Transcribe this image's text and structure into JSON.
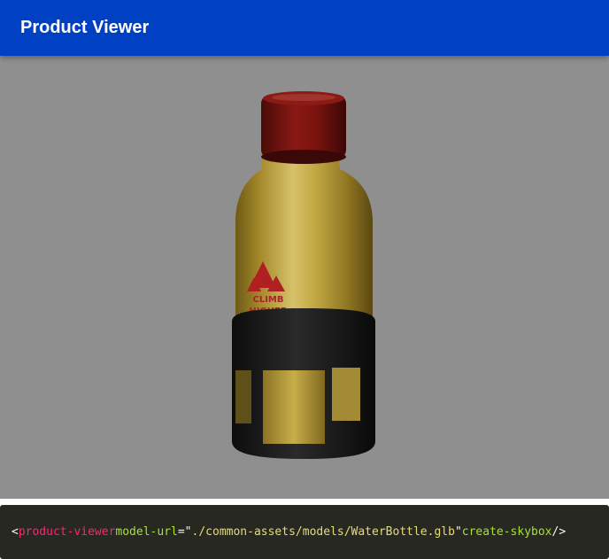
{
  "header": {
    "title": "Product Viewer",
    "color": "#0041c4"
  },
  "viewer": {
    "background": "#8f8f8f",
    "bottle_label_lines": [
      "CLIMB",
      "HIGHER"
    ]
  },
  "code": {
    "open": "<",
    "tag": "product-viewer",
    "attr1_name": "model-url",
    "attr1_eq": "=\"",
    "attr1_value": "./common-assets/models/WaterBottle.glb",
    "attr1_close": "\"",
    "attr2_name": "create-skybox",
    "close": " />"
  }
}
